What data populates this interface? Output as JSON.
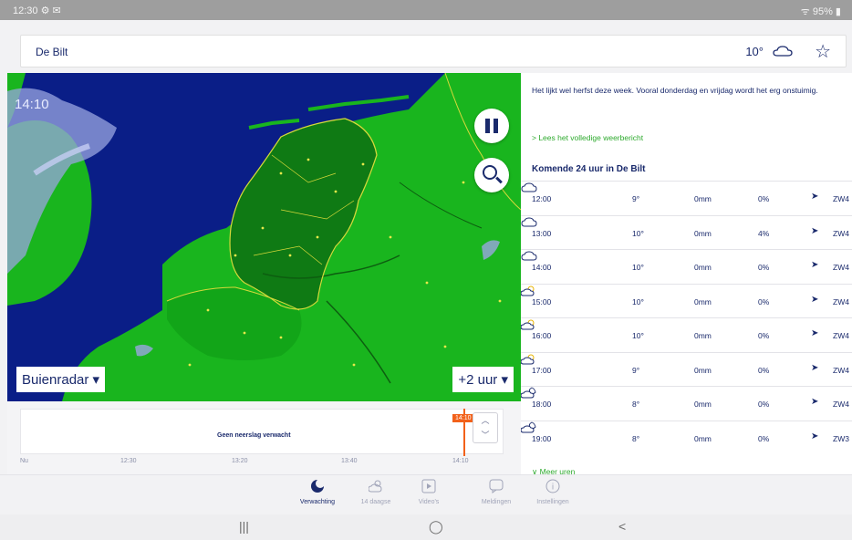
{
  "statusbar": {
    "left": "12:30 ⚙ ✉",
    "right": "ᯤ 95% ▮"
  },
  "header": {
    "location": "De Bilt",
    "temp": "10°",
    "cloud_icon": "cloud-icon",
    "star_icon": "star-icon"
  },
  "map": {
    "time": "14:10",
    "layer_label": "Buienradar ▾",
    "range_label": "+2 uur ▾"
  },
  "timeline": {
    "message": "Geen neerslag verwacht",
    "now_tag": "14:10",
    "ticks": [
      "Nu",
      "12:30",
      "13:20",
      "13:40",
      "14:10"
    ]
  },
  "panel": {
    "summary": "Het lijkt wel herfst deze week. Vooral donderdag en vrijdag wordt het erg onstuimig.",
    "readmore": "> Lees het volledige weerbericht",
    "forecast_title": "Komende 24 uur in De Bilt",
    "rows": [
      {
        "time": "12:00",
        "icon": "cloud-icon",
        "temp": "9°",
        "rain": "0mm",
        "prob": "0%",
        "wind": "ZW4"
      },
      {
        "time": "13:00",
        "icon": "cloud-icon",
        "temp": "10°",
        "rain": "0mm",
        "prob": "4%",
        "wind": "ZW4"
      },
      {
        "time": "14:00",
        "icon": "cloud-icon",
        "temp": "10°",
        "rain": "0mm",
        "prob": "0%",
        "wind": "ZW4"
      },
      {
        "time": "15:00",
        "icon": "sun-cloud-icon",
        "temp": "10°",
        "rain": "0mm",
        "prob": "0%",
        "wind": "ZW4"
      },
      {
        "time": "16:00",
        "icon": "sun-cloud-icon",
        "temp": "10°",
        "rain": "0mm",
        "prob": "0%",
        "wind": "ZW4"
      },
      {
        "time": "17:00",
        "icon": "sun-cloud-icon",
        "temp": "9°",
        "rain": "0mm",
        "prob": "0%",
        "wind": "ZW4"
      },
      {
        "time": "18:00",
        "icon": "moon-cloud-icon",
        "temp": "8°",
        "rain": "0mm",
        "prob": "0%",
        "wind": "ZW4"
      },
      {
        "time": "19:00",
        "icon": "moon-cloud-icon",
        "temp": "8°",
        "rain": "0mm",
        "prob": "0%",
        "wind": "ZW3"
      }
    ],
    "more_hours": "∨ Meer uren"
  },
  "bottomnav": [
    {
      "label": "Verwachting",
      "icon": "moon-icon",
      "active": true
    },
    {
      "label": "14 daagse",
      "icon": "sun-cloud-icon",
      "active": false
    },
    {
      "label": "Video's",
      "icon": "play-icon",
      "active": false
    },
    {
      "label": "Meldingen",
      "icon": "message-icon",
      "active": false
    },
    {
      "label": "Instellingen",
      "icon": "settings-icon",
      "active": false
    }
  ],
  "sysnav": {
    "recent": "|||",
    "home": "◯",
    "back": "<"
  },
  "colors": {
    "accent_dark": "#1a2a6c",
    "green_link": "#2eaa2e",
    "map_sea": "#0a1e87",
    "map_land": "#19b51e",
    "map_nl": "#0f7a14",
    "timeline_marker": "#f2611a"
  }
}
